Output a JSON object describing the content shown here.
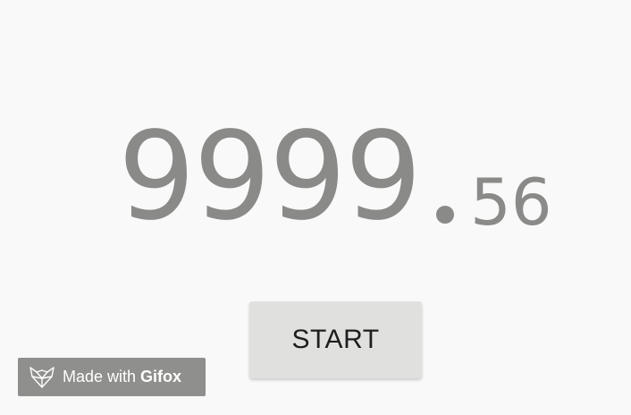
{
  "timer": {
    "main": "9999",
    "fraction": "56"
  },
  "controls": {
    "start_label": "START"
  },
  "badge": {
    "prefix": "Made with",
    "brand": "Gifox",
    "icon": "fox-icon"
  },
  "colors": {
    "background": "#f8f9f8",
    "timer_text": "#8a8a88",
    "button_bg": "#e0e0df",
    "badge_bg": "#8f8f8d"
  }
}
